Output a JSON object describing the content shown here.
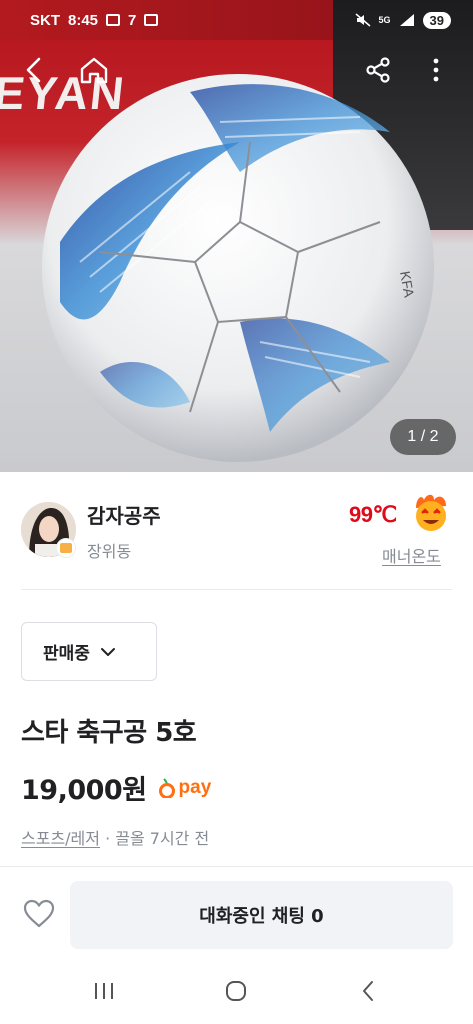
{
  "status_bar": {
    "carrier": "SKT",
    "time": "8:45",
    "notification_count": "7",
    "network": "5G",
    "battery": "39"
  },
  "hero": {
    "brand_text": "EYAN",
    "ball_print": "KFA",
    "page_indicator": "1 / 2"
  },
  "seller": {
    "name": "감자공주",
    "location": "장위동",
    "temperature": "99℃",
    "manner_label": "매너온도"
  },
  "listing": {
    "status": "판매중",
    "title": "스타 축구공 5호",
    "price": "19,000원",
    "pay_label": "pay",
    "category": "스포츠/레저",
    "time_info": " · 끌올 7시간 전"
  },
  "bottom_bar": {
    "chat_label": "대화중인 채팅 0"
  },
  "colors": {
    "accent": "#ff6f0f",
    "temperature": "#de0a19",
    "muted": "#868b94"
  },
  "icons": {
    "back": "chevron-left-icon",
    "home": "home-icon",
    "share": "share-icon",
    "more": "more-vertical-icon",
    "status": "chevron-down-icon",
    "like": "heart-icon"
  }
}
